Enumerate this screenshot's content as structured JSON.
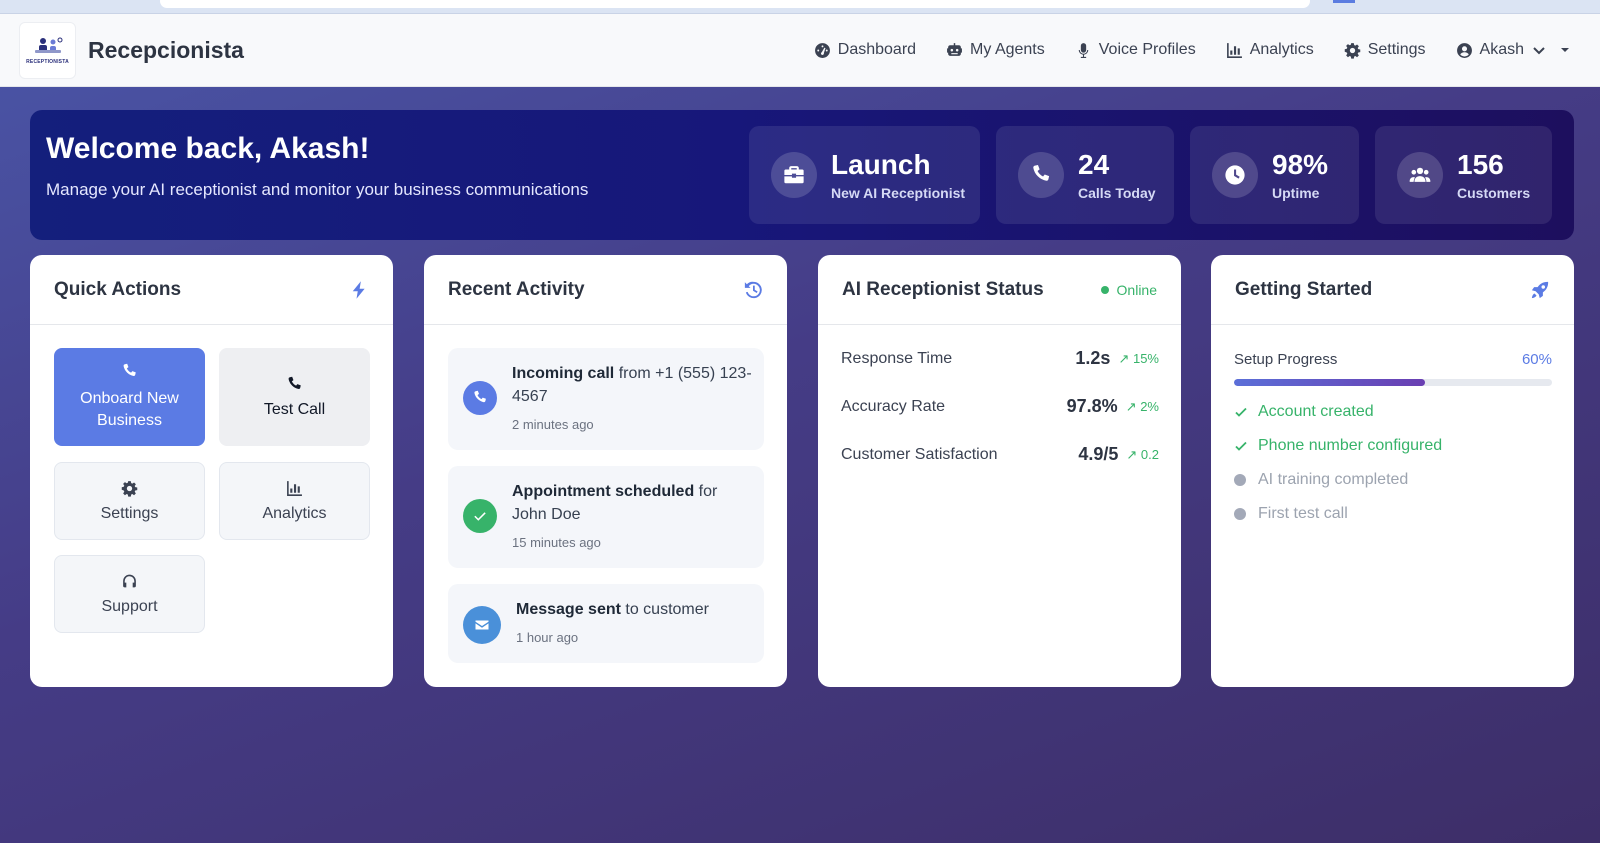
{
  "app": {
    "name": "Recepcionista",
    "logo_text": "RECEPTIONISTA"
  },
  "nav": {
    "items": [
      {
        "label": "Dashboard"
      },
      {
        "label": "My Agents"
      },
      {
        "label": "Voice Profiles"
      },
      {
        "label": "Analytics"
      },
      {
        "label": "Settings"
      }
    ],
    "user": "Akash"
  },
  "hero": {
    "title": "Welcome back, Akash!",
    "subtitle": "Manage your AI receptionist and monitor your business communications",
    "stats": [
      {
        "value": "Launch",
        "label": "New AI Receptionist",
        "icon": "briefcase-icon"
      },
      {
        "value": "24",
        "label": "Calls Today",
        "icon": "phone-icon"
      },
      {
        "value": "98%",
        "label": "Uptime",
        "icon": "clock-icon"
      },
      {
        "value": "156",
        "label": "Customers",
        "icon": "users-icon"
      }
    ]
  },
  "quick_actions": {
    "title": "Quick Actions",
    "buttons": [
      {
        "label": "Onboard New Business"
      },
      {
        "label": "Test Call"
      },
      {
        "label": "Settings"
      },
      {
        "label": "Analytics"
      },
      {
        "label": "Support"
      }
    ]
  },
  "recent_activity": {
    "title": "Recent Activity",
    "items": [
      {
        "bold": "Incoming call",
        "rest": " from +1 (555) 123-4567",
        "time": "2 minutes ago"
      },
      {
        "bold": "Appointment scheduled",
        "rest": " for John Doe",
        "time": "15 minutes ago"
      },
      {
        "bold": "Message sent",
        "rest": " to customer",
        "time": "1 hour ago"
      }
    ]
  },
  "status": {
    "title": "AI Receptionist Status",
    "state": "Online",
    "metrics": [
      {
        "label": "Response Time",
        "value": "1.2s",
        "delta": "15%"
      },
      {
        "label": "Accuracy Rate",
        "value": "97.8%",
        "delta": "2%"
      },
      {
        "label": "Customer Satisfaction",
        "value": "4.9/5",
        "delta": "0.2"
      }
    ]
  },
  "getting_started": {
    "title": "Getting Started",
    "progress_label": "Setup Progress",
    "progress_value": "60%",
    "progress_fraction": 0.6,
    "steps": [
      {
        "label": "Account created",
        "done": true
      },
      {
        "label": "Phone number configured",
        "done": true
      },
      {
        "label": "AI training completed",
        "done": false
      },
      {
        "label": "First test call",
        "done": false
      }
    ]
  },
  "colors": {
    "accent": "#5b7be4",
    "success": "#37b36a",
    "hero": "#17177a"
  }
}
